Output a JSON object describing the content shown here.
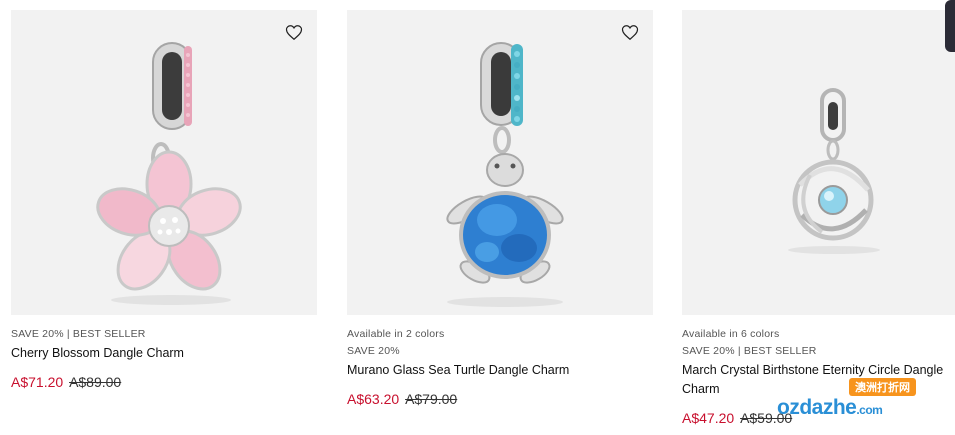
{
  "products": [
    {
      "image_alt": "Cherry Blossom Dangle Charm",
      "colors_note": "",
      "badges": "SAVE 20% | BEST SELLER",
      "name": "Cherry Blossom Dangle Charm",
      "price_now": "A$71.20",
      "price_was": "A$89.00",
      "wishlist_icon": "heart-icon"
    },
    {
      "image_alt": "Murano Glass Sea Turtle Dangle Charm",
      "colors_note": "Available in 2 colors",
      "badges": "SAVE 20%",
      "name": "Murano Glass Sea Turtle Dangle Charm",
      "price_now": "A$63.20",
      "price_was": "A$79.00",
      "wishlist_icon": "heart-icon"
    },
    {
      "image_alt": "March Crystal Birthstone Eternity Circle Dangle Charm",
      "colors_note": "Available in 6 colors",
      "badges": "SAVE 20% | BEST SELLER",
      "name": "March Crystal Birthstone Eternity Circle Dangle Charm",
      "price_now": "A$47.20",
      "price_was": "A$59.00",
      "wishlist_icon": "heart-icon"
    }
  ],
  "watermark": {
    "badge": "澳洲打折网",
    "brand": "ozdazhe",
    "suffix": ".com"
  },
  "colors": {
    "sale_price": "#c8102e",
    "image_bg": "#f2f2f2",
    "text": "#111111",
    "meta": "#555555"
  }
}
